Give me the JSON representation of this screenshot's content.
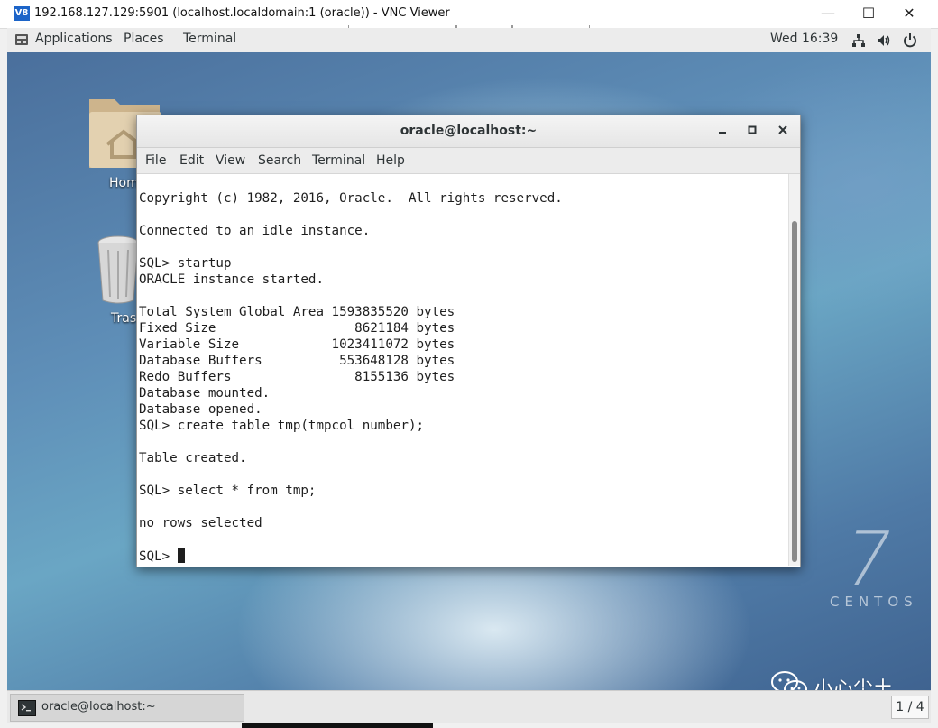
{
  "vnc": {
    "logo": "V8",
    "title": "192.168.127.129:5901 (localhost.localdomain:1 (oracle)) - VNC Viewer",
    "minimize": "—",
    "maximize": "☐",
    "close": "✕"
  },
  "topbar": {
    "applications": "Applications",
    "places": "Places",
    "terminal": "Terminal",
    "clock": "Wed 16:39",
    "icons": [
      "network-icon",
      "volume-icon",
      "power-icon"
    ]
  },
  "desktop": {
    "icons": [
      {
        "name": "home-folder",
        "label": "Hom"
      },
      {
        "name": "trash",
        "label": "Tras"
      }
    ],
    "brand_number": "7",
    "brand_word": "CENTOS",
    "watermark": "小心尘土"
  },
  "terminal": {
    "title": "oracle@localhost:~",
    "menu": [
      "File",
      "Edit",
      "View",
      "Search",
      "Terminal",
      "Help"
    ],
    "lines": [
      "Copyright (c) 1982, 2016, Oracle.  All rights reserved.",
      "",
      "Connected to an idle instance.",
      "",
      "SQL> startup",
      "ORACLE instance started.",
      "",
      "Total System Global Area 1593835520 bytes",
      "Fixed Size                  8621184 bytes",
      "Variable Size            1023411072 bytes",
      "Database Buffers          553648128 bytes",
      "Redo Buffers                8155136 bytes",
      "Database mounted.",
      "Database opened.",
      "SQL> create table tmp(tmpcol number);",
      "",
      "Table created.",
      "",
      "SQL> select * from tmp;",
      "",
      "no rows selected",
      "",
      "SQL> "
    ]
  },
  "taskbar": {
    "item_label": "oracle@localhost:~",
    "pager": "1 / 4"
  }
}
